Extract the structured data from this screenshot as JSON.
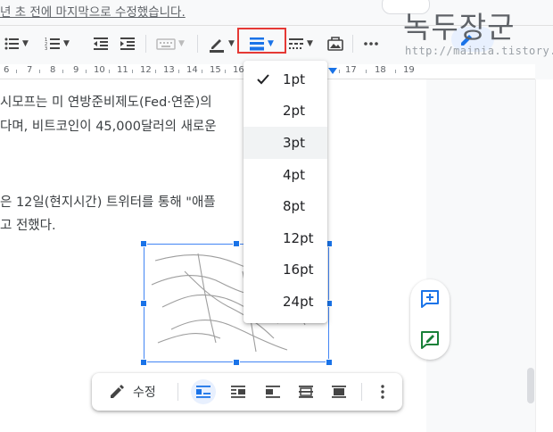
{
  "header": {
    "last_edit": "년 초 전에 마지막으로 수정했습니다."
  },
  "watermark": {
    "title": "녹두장군",
    "url": "http://mainia.tistory.com"
  },
  "ruler": {
    "numbers": [
      "6",
      "7",
      "8",
      "9",
      "10",
      "11",
      "12",
      "13",
      "14",
      "15",
      "16",
      "17",
      "18",
      "19"
    ]
  },
  "document": {
    "lines": [
      "시모프는 미 연방준비제도(Fed·연준)의",
      "다며, 비트코인이 45,000달러의 새로운",
      "은 12일(현지시간) 트위터를 통해 \"애플",
      "고 전했다."
    ]
  },
  "border_weight_menu": {
    "selected": "1pt",
    "hovered": "3pt",
    "options": [
      "1pt",
      "2pt",
      "3pt",
      "4pt",
      "8pt",
      "12pt",
      "16pt",
      "24pt"
    ]
  },
  "image_toolbar": {
    "edit_label": "수정"
  },
  "colors": {
    "accent": "#1a73e8",
    "highlight_box": "#e53935",
    "comment_icon": "#1a73e8",
    "suggest_icon": "#188038"
  }
}
